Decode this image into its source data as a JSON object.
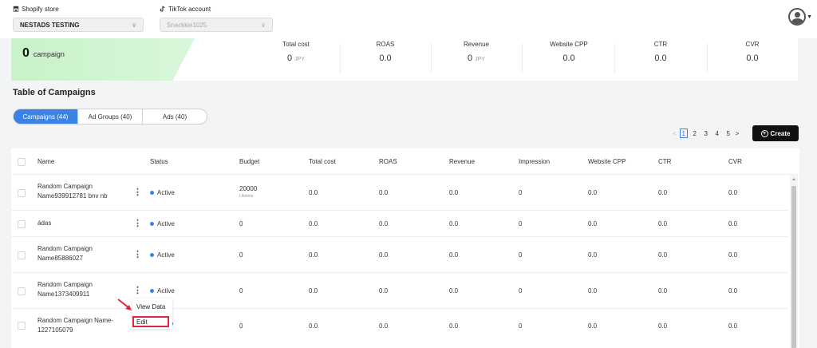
{
  "header": {
    "store_label": "Shopify store",
    "store_value": "NESTADS TESTING",
    "tiktok_label": "TikTok account",
    "tiktok_value": "Snackkie1025"
  },
  "stats": {
    "campaign_count": "0",
    "campaign_label": "campaign",
    "metrics": [
      {
        "title": "Total cost",
        "value": "0",
        "unit": "JPY"
      },
      {
        "title": "ROAS",
        "value": "0.0",
        "unit": ""
      },
      {
        "title": "Revenue",
        "value": "0",
        "unit": "JPY"
      },
      {
        "title": "Website CPP",
        "value": "0.0",
        "unit": ""
      },
      {
        "title": "CTR",
        "value": "0.0",
        "unit": ""
      },
      {
        "title": "CVR",
        "value": "0.0",
        "unit": ""
      }
    ]
  },
  "section_title": "Table of Campaigns",
  "tabs": [
    {
      "label": "Campaigns (44)",
      "active": true
    },
    {
      "label": "Ad Groups (40)",
      "active": false
    },
    {
      "label": "Ads (40)",
      "active": false
    }
  ],
  "pagination": {
    "prev": "<",
    "pages": [
      "1",
      "2",
      "3",
      "4",
      "5"
    ],
    "current": "1",
    "next": ">"
  },
  "create_label": "Create",
  "table": {
    "columns": [
      "Name",
      "Status",
      "Budget",
      "Total cost",
      "ROAS",
      "Revenue",
      "Impression",
      "Website CPP",
      "CTR",
      "CVR"
    ],
    "rows": [
      {
        "name_line1": "Random Campaign",
        "name_line2": "Name939912781 bnv nb",
        "status": "Active",
        "budget": "20000",
        "budget_sub": "Lifetime",
        "total_cost": "0.0",
        "roas": "0.0",
        "revenue": "0.0",
        "impression": "0",
        "website_cpp": "0.0",
        "ctr": "0.0",
        "cvr": "0.0"
      },
      {
        "name_line1": "ádas",
        "name_line2": "",
        "status": "Active",
        "budget": "0",
        "budget_sub": "",
        "total_cost": "0.0",
        "roas": "0.0",
        "revenue": "0.0",
        "impression": "0",
        "website_cpp": "0.0",
        "ctr": "0.0",
        "cvr": "0.0"
      },
      {
        "name_line1": "Random Campaign",
        "name_line2": "Name85886027",
        "status": "Active",
        "budget": "0",
        "budget_sub": "",
        "total_cost": "0.0",
        "roas": "0.0",
        "revenue": "0.0",
        "impression": "0",
        "website_cpp": "0.0",
        "ctr": "0.0",
        "cvr": "0.0"
      },
      {
        "name_line1": "Random Campaign",
        "name_line2": "Name1373409911",
        "status": "Active",
        "budget": "0",
        "budget_sub": "",
        "total_cost": "0.0",
        "roas": "0.0",
        "revenue": "0.0",
        "impression": "0",
        "website_cpp": "0.0",
        "ctr": "0.0",
        "cvr": "0.0"
      },
      {
        "name_line1": "Random Campaign Name-",
        "name_line2": "1227105079",
        "status": "",
        "budget": "0",
        "budget_sub": "",
        "total_cost": "0.0",
        "roas": "0.0",
        "revenue": "0.0",
        "impression": "0",
        "website_cpp": "0.0",
        "ctr": "0.0",
        "cvr": "0.0"
      }
    ]
  },
  "context_menu": {
    "view_data": "View Data",
    "edit": "Edit"
  },
  "colors": {
    "accent": "#3b82e6",
    "highlight": "#e0283c",
    "green_panel": "#c8f2c9"
  }
}
